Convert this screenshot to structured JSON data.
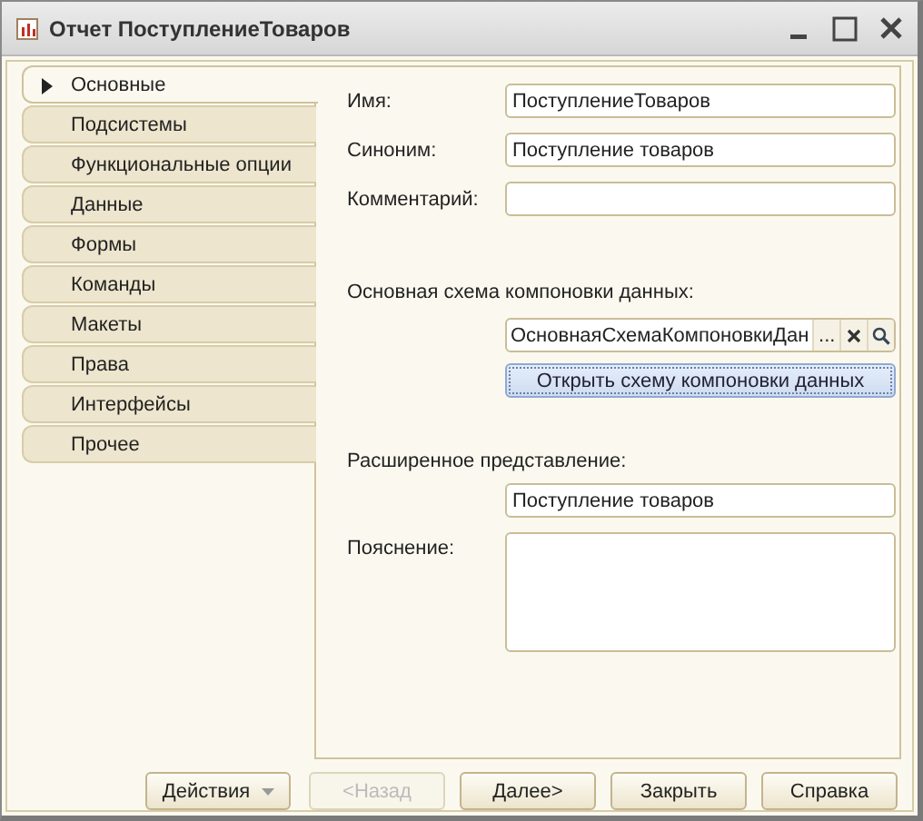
{
  "window": {
    "title": "Отчет ПоступлениеТоваров"
  },
  "tabs": [
    {
      "label": "Основные",
      "selected": true
    },
    {
      "label": "Подсистемы",
      "selected": false
    },
    {
      "label": "Функциональные опции",
      "selected": false
    },
    {
      "label": "Данные",
      "selected": false
    },
    {
      "label": "Формы",
      "selected": false
    },
    {
      "label": "Команды",
      "selected": false
    },
    {
      "label": "Макеты",
      "selected": false
    },
    {
      "label": "Права",
      "selected": false
    },
    {
      "label": "Интерфейсы",
      "selected": false
    },
    {
      "label": "Прочее",
      "selected": false
    }
  ],
  "form": [
    {
      "kind": "field",
      "label": "Имя:",
      "value": "ПоступлениеТоваров"
    },
    {
      "kind": "field",
      "label": "Синоним:",
      "value": "Поступление товаров"
    },
    {
      "kind": "field",
      "label": "Комментарий:"
    },
    {
      "kind": "heading",
      "label": "Основная схема компоновки данных:"
    },
    {
      "kind": "ref",
      "value": "ОсновнаяСхемаКомпоновкиДан",
      "select": "..."
    },
    {
      "kind": "button",
      "label": "Открыть схему компоновки данных"
    },
    {
      "kind": "heading",
      "label": "Расширенное представление:"
    },
    {
      "kind": "field",
      "value": "Поступление товаров"
    },
    {
      "kind": "memo",
      "label": "Пояснение:"
    }
  ],
  "buttons": [
    {
      "label": "Действия",
      "dropdown": true,
      "disabled": false
    },
    {
      "label": "<Назад",
      "dropdown": false,
      "disabled": true
    },
    {
      "label": "Далее>",
      "dropdown": false,
      "disabled": false
    },
    {
      "label": "Закрыть",
      "dropdown": false,
      "disabled": false
    },
    {
      "label": "Справка",
      "dropdown": false,
      "disabled": false
    }
  ]
}
